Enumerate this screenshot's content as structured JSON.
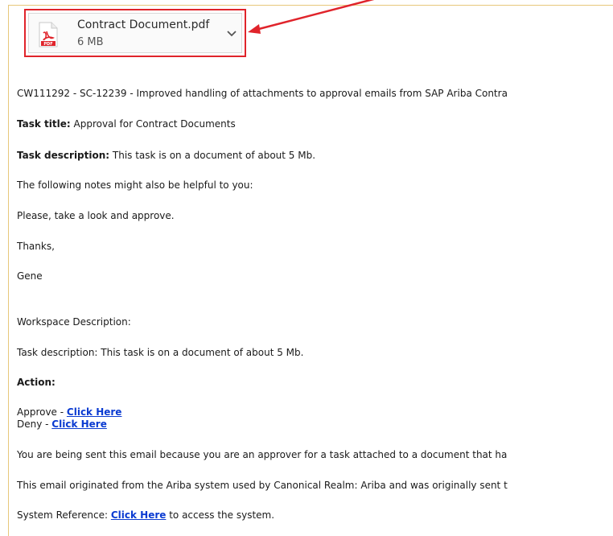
{
  "attachment": {
    "file_name": "Contract Document.pdf",
    "file_size": "6 MB",
    "icon": "pdf-icon"
  },
  "email": {
    "subject_line": "CW111292 - SC-12239 - Improved handling of attachments to approval emails from SAP Ariba Contra",
    "task_title_label": "Task title:",
    "task_title_value": " Approval for Contract Documents",
    "task_description_label": "Task description:",
    "task_description_value": " This task is on a document of about 5 Mb.",
    "notes_intro": "The following notes might also be helpful to you:",
    "note_text": "Please, take a look and approve.",
    "sign_off": "Thanks,",
    "sender_name": "Gene",
    "workspace_description_label": "Workspace Description:",
    "workspace_task_description": "Task description: This task is on a document of about 5 Mb.",
    "action_heading": "Action:",
    "approve_prefix": "Approve - ",
    "approve_link": "Click Here",
    "deny_prefix": "Deny - ",
    "deny_link": "Click Here",
    "approver_notice": "You are being sent this email because you are an approver for a task attached to a document that ha",
    "origin_notice": "This email originated from the Ariba system used by Canonical Realm: Ariba and was originally sent t",
    "system_reference_prefix": "System Reference: ",
    "system_reference_link": "Click Here",
    "system_reference_suffix": " to access the system."
  },
  "colors": {
    "highlight_border": "#e0242b",
    "arrow": "#e0242b",
    "link": "#0b3bd1",
    "frame_border": "#e8c77a"
  }
}
